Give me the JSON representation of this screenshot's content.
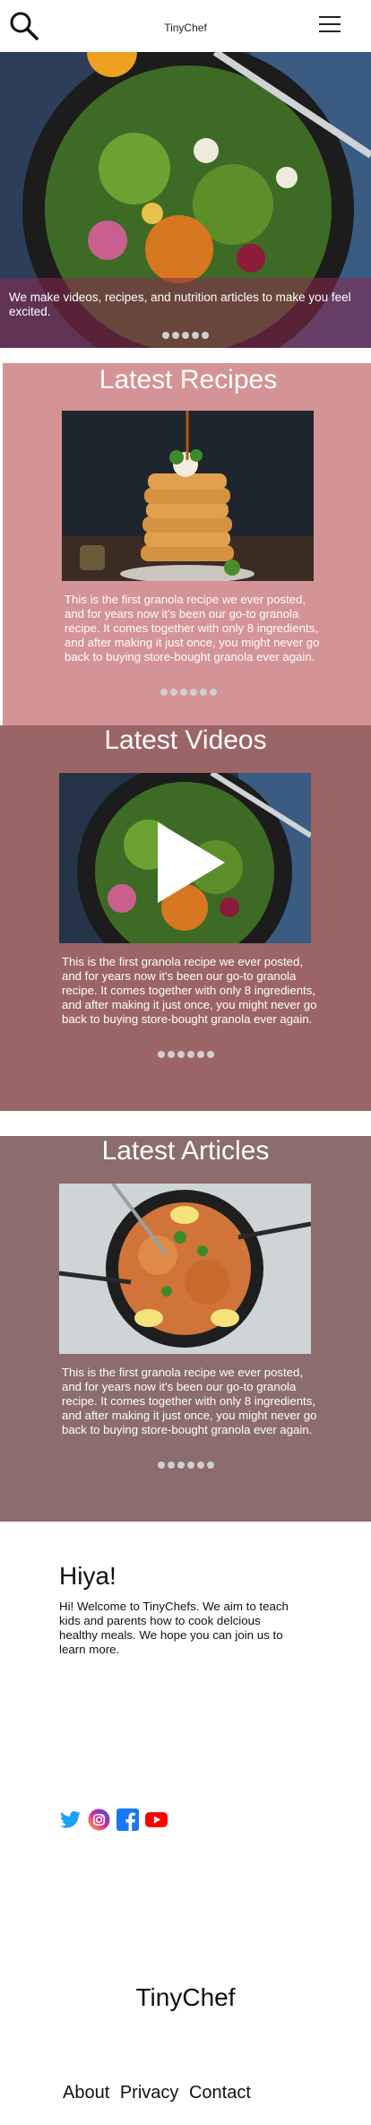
{
  "header": {
    "title": "TinyChef"
  },
  "hero": {
    "caption": "We make videos, recipes, and nutrition articles to make you feel excited.",
    "slide_count": 5
  },
  "recipes": {
    "title": "Latest Recipes",
    "description": "This is the first granola recipe we ever posted, and for years now it's been our go-to granola recipe. It comes together with only 8 ingredients, and after making it just once, you might never go back to buying store-bought granola ever again.",
    "slide_count": 6
  },
  "videos": {
    "title": "Latest Videos",
    "description": "This is the first granola recipe we ever posted, and for years now it's been our go-to granola recipe. It comes together with only 8 ingredients, and after making it just once, you might never go back to buying store-bought granola ever again.",
    "slide_count": 6
  },
  "articles": {
    "title": "Latest Articles",
    "description": "This is the first granola recipe we ever posted, and for years now it's been our go-to granola recipe. It comes together with only 8 ingredients, and after making it just once, you might never go back to buying store-bought granola ever again.",
    "slide_count": 6
  },
  "welcome": {
    "heading": "Hiya!",
    "body": "Hi! Welcome to TinyChefs. We aim to teach kids and parents how to cook delcious healthy meals. We hope you can join us to learn  more."
  },
  "social": [
    {
      "icon": "twitter-icon",
      "color": "#1da1f2"
    },
    {
      "icon": "instagram-icon",
      "color": "#d6249f"
    },
    {
      "icon": "facebook-icon",
      "color": "#1877f2"
    },
    {
      "icon": "youtube-icon",
      "color": "#ff0000"
    }
  ],
  "footer": {
    "brand": "TinyChef",
    "links": [
      "About",
      "Privacy",
      "Contact"
    ]
  }
}
